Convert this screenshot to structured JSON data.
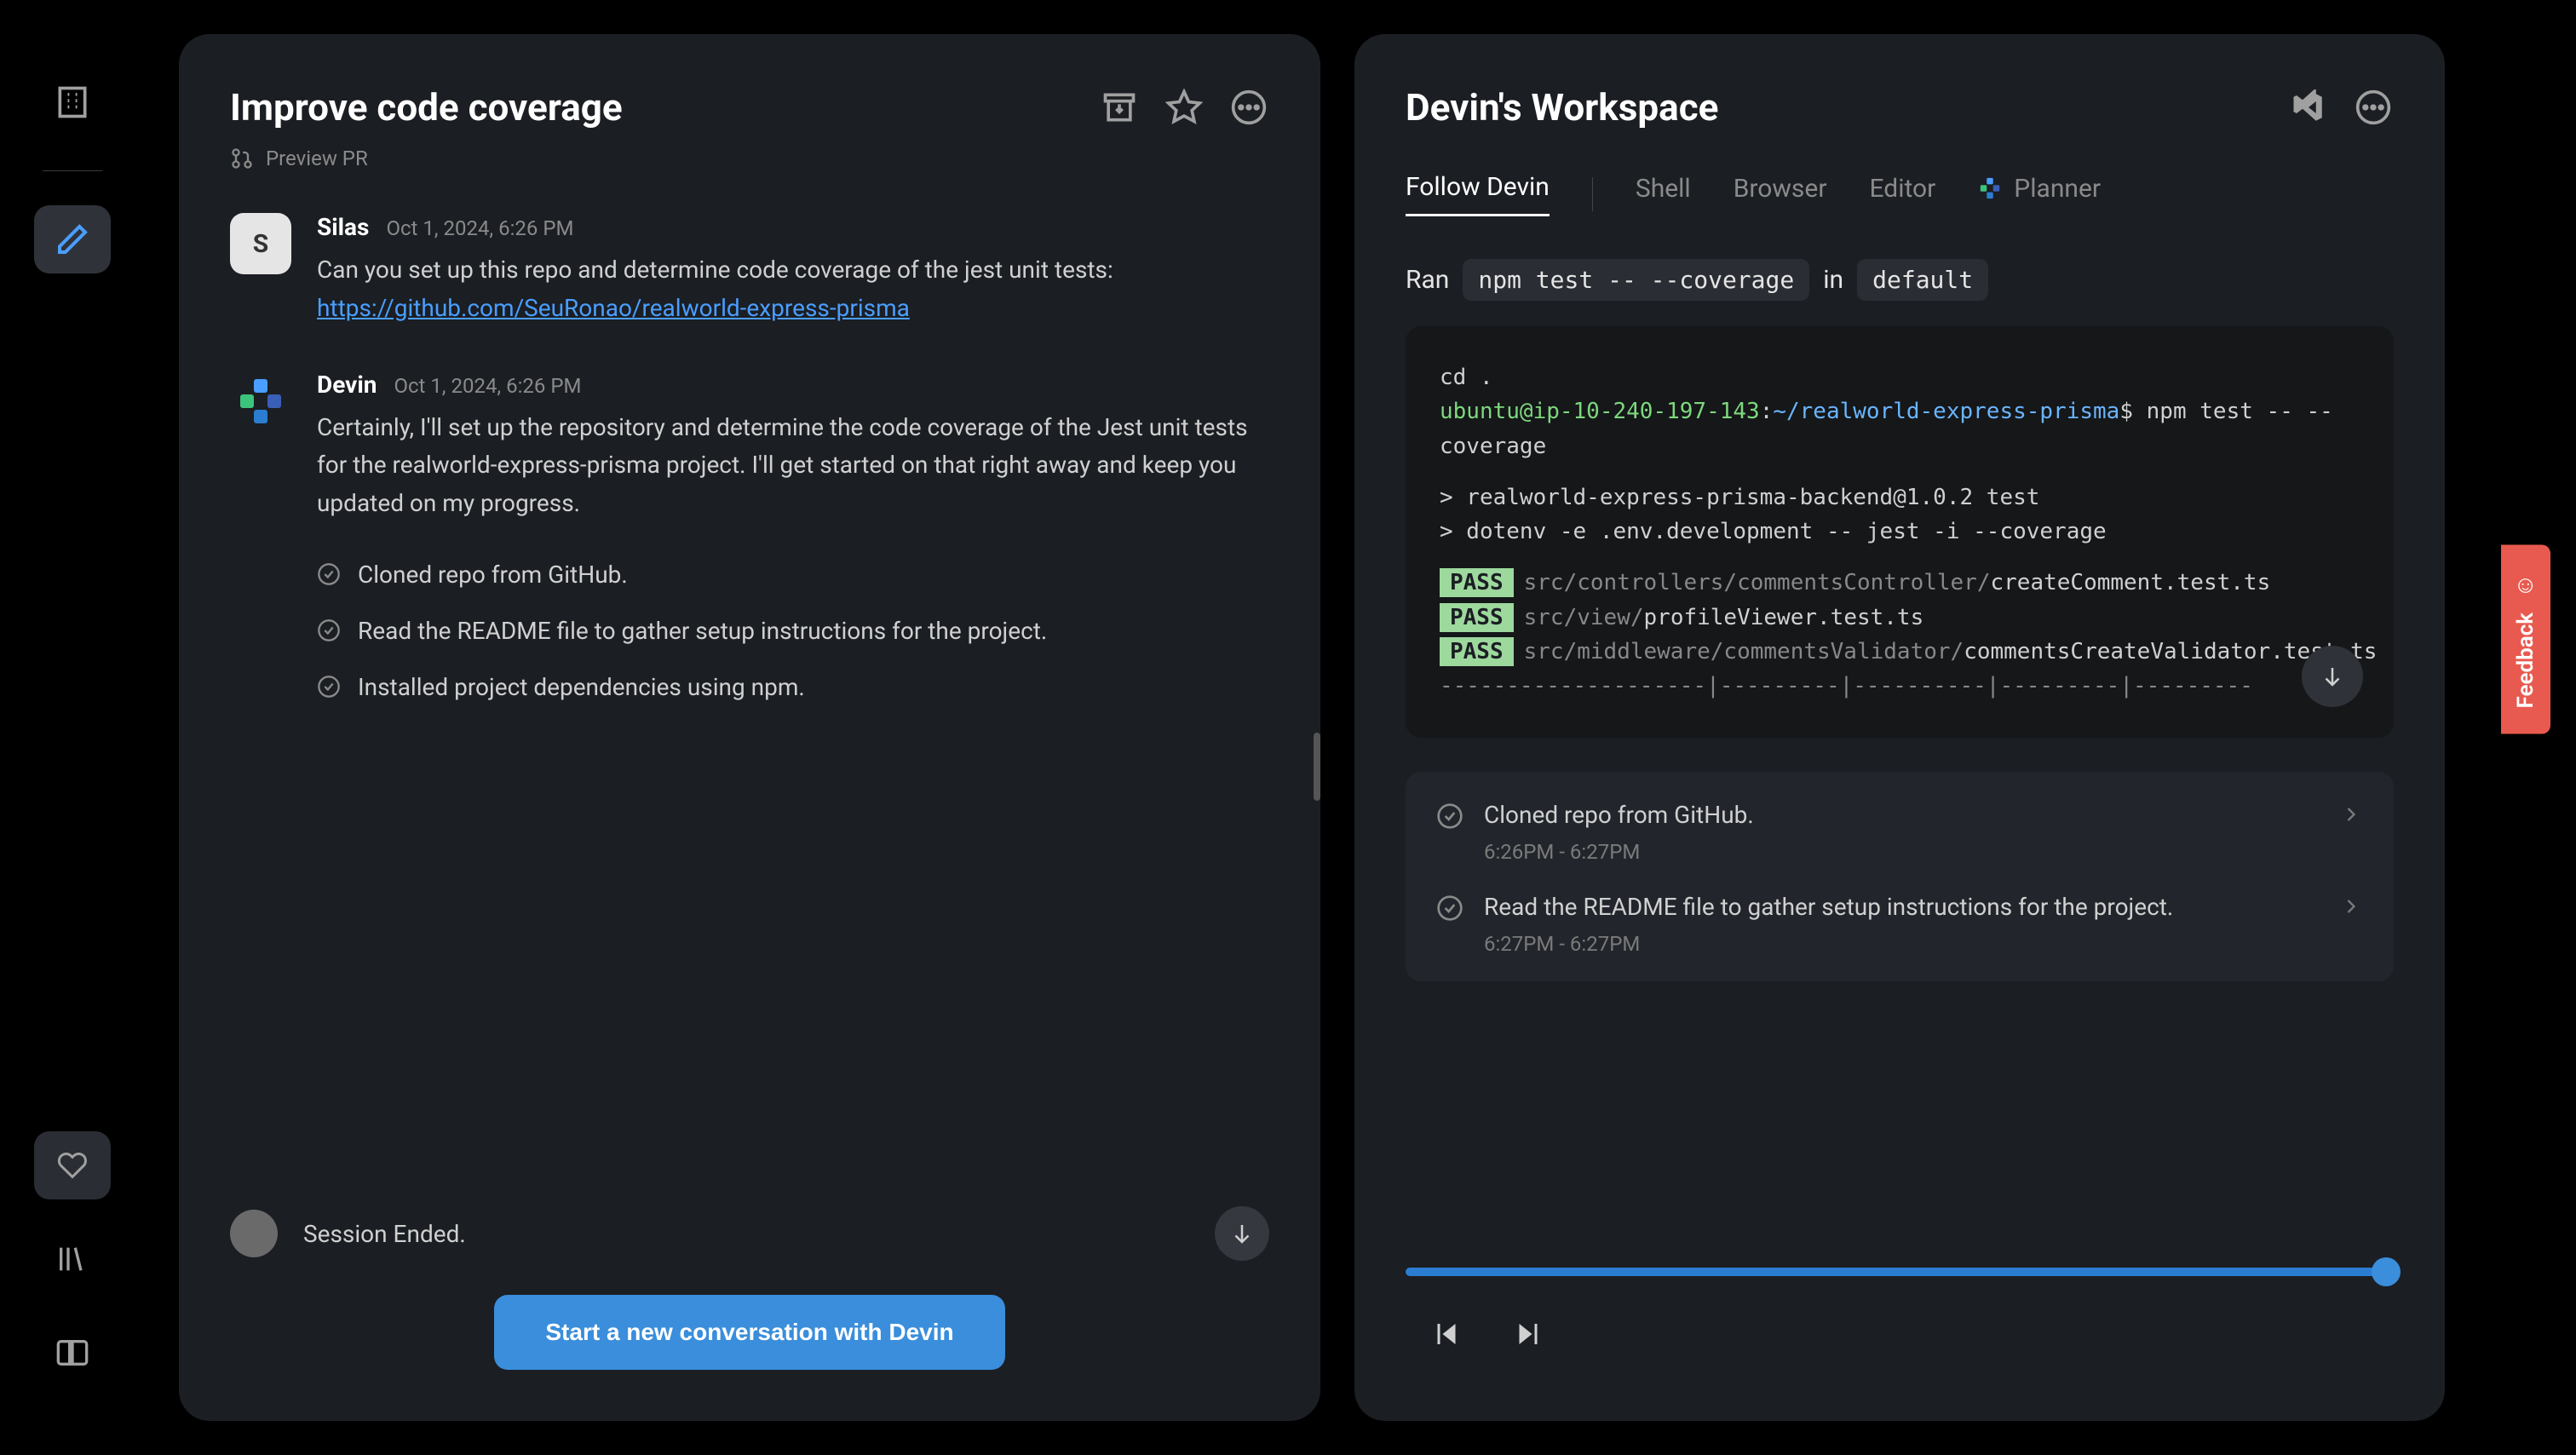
{
  "sidebar": {
    "org_icon": "building-icon",
    "edit_icon": "pencil-icon",
    "heart_icon": "heart-icon",
    "library_icon": "books-icon",
    "docs_icon": "book-open-icon"
  },
  "left": {
    "title": "Improve code coverage",
    "header_icons": [
      "archive-icon",
      "star-icon",
      "more-icon"
    ],
    "preview_pr": "Preview PR",
    "messages": [
      {
        "author": "Silas",
        "avatar_letter": "S",
        "time": "Oct 1, 2024, 6:26 PM",
        "text_prefix": "Can you set up this repo and determine code coverage of the jest unit tests: ",
        "link": "https://github.com/SeuRonao/realworld-express-prisma"
      },
      {
        "author": "Devin",
        "time": "Oct 1, 2024, 6:26 PM",
        "text": "Certainly, I'll set up the repository and determine the code coverage of the Jest unit tests for the realworld-express-prisma project. I'll get started on that right away and keep you updated on my progress.",
        "checklist": [
          "Cloned repo from GitHub.",
          "Read the README file to gather setup instructions for the project.",
          "Installed project dependencies using npm."
        ]
      }
    ],
    "session_ended": "Session Ended.",
    "cta": "Start a new conversation with Devin"
  },
  "right": {
    "title": "Devin's Workspace",
    "header_icons": [
      "vscode-icon",
      "more-icon"
    ],
    "tabs": [
      "Follow Devin",
      "Shell",
      "Browser",
      "Editor",
      "Planner"
    ],
    "active_tab": "Follow Devin",
    "cmd_prefix": "Ran",
    "cmd": "npm test -- --coverage",
    "cmd_in": "in",
    "cmd_target": "default",
    "terminal": {
      "line1": "cd .",
      "prompt_user": "ubuntu@ip-10-240-197-143",
      "prompt_path": "~/realworld-express-prisma",
      "prompt_cmd": "npm test -- --coverage",
      "line3": "> realworld-express-prisma-backend@1.0.2 test",
      "line4": "> dotenv -e .env.development -- jest -i --coverage",
      "pass": "PASS",
      "p1_dir": "src/controllers/commentsController/",
      "p1_file": "createComment.test.ts",
      "p2_dir": "src/view/",
      "p2_file": "profileViewer.test.ts",
      "p3_dir": "src/middleware/commentsValidator/",
      "p3_file": "commentsCreateValidator.test.ts",
      "divider": "--------------------|---------|----------|---------|---------"
    },
    "activities": [
      {
        "title": "Cloned repo from GitHub.",
        "time": "6:26PM - 6:27PM"
      },
      {
        "title": "Read the README file to gather setup instructions for the project.",
        "time": "6:27PM - 6:27PM"
      }
    ]
  },
  "feedback": "Feedback"
}
